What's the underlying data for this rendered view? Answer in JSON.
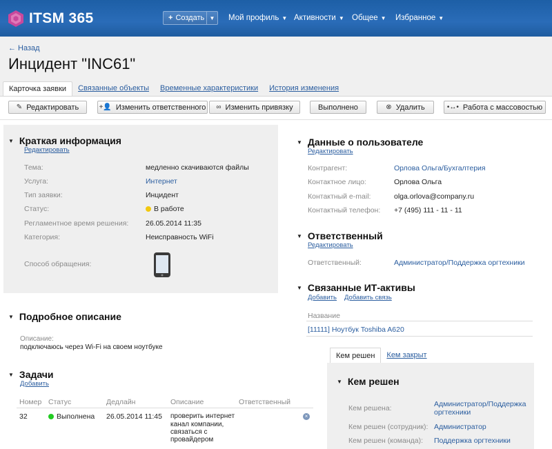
{
  "logo": {
    "text": "ITSM 365"
  },
  "nav": {
    "create": "Создать",
    "items": [
      "Мой профиль",
      "Активности",
      "Общее",
      "Избранное"
    ]
  },
  "header": {
    "back": "← Назад",
    "title": "Инцидент \"INC61\""
  },
  "tabs": [
    "Карточка заявки",
    "Связанные объекты",
    "Временные характеристики",
    "История изменения"
  ],
  "actions": {
    "edit": "Редактировать",
    "change_responsible": "Изменить ответственного",
    "change_binding": "Изменить привязку",
    "done": "Выполнено",
    "delete": "Удалить",
    "bulk": "Работа с массовостью"
  },
  "brief": {
    "title": "Краткая информация",
    "edit": "Редактировать",
    "rows": [
      {
        "label": "Тема:",
        "value": "медленно скачиваются файлы"
      },
      {
        "label": "Услуга:",
        "value": "Интернет"
      },
      {
        "label": "Тип заявки:",
        "value": "Инцидент"
      },
      {
        "label": "Статус:",
        "value": "В работе"
      },
      {
        "label": "Регламентное время решения:",
        "value": "26.05.2014 11:35"
      },
      {
        "label": "Категория:",
        "value": "Неисправность WiFi"
      },
      {
        "label": "Способ обращения:",
        "value": ""
      }
    ]
  },
  "description": {
    "title": "Подробное описание",
    "label": "Описание:",
    "text": "подключаюсь через Wi-Fi на своем ноутбуке"
  },
  "tasks": {
    "title": "Задачи",
    "add": "Добавить",
    "headers": [
      "Номер",
      "Статус",
      "Дедлайн",
      "Описание",
      "Ответственный"
    ],
    "rows": [
      {
        "num": "32",
        "status": "Выполнена",
        "deadline": "26.05.2014 11:45",
        "desc1": "проверить интернет",
        "desc2": "канал компании,",
        "desc3": "связаться с",
        "desc4": "провайдером",
        "resp": ""
      }
    ]
  },
  "user": {
    "title": "Данные о пользователе",
    "edit": "Редактировать",
    "rows": [
      {
        "label": "Контрагент:",
        "value": "Орлова Ольга/Бухгалтерия"
      },
      {
        "label": "Контактное лицо:",
        "value": "Орлова Ольга"
      },
      {
        "label": "Контактный e-mail:",
        "value": "olga.orlova@company.ru"
      },
      {
        "label": "Контактный телефон:",
        "value": "+7 (495) 111 - 11 - 11"
      }
    ]
  },
  "responsible": {
    "title": "Ответственный",
    "edit": "Редактировать",
    "label": "Ответственный:",
    "value": "Администратор/Поддержка оргтехники"
  },
  "assets": {
    "title": "Связанные ИТ-активы",
    "add": "Добавить",
    "add_link": "Добавить связь",
    "col": "Название",
    "item": "[11111] Ноутбук Toshiba A620"
  },
  "resolved": {
    "tabs": [
      "Кем решен",
      "Кем закрыт"
    ],
    "title": "Кем решен",
    "rows": [
      {
        "label": "Кем решена:",
        "value1": "Администратор/Поддержка",
        "value2": "оргтехники"
      },
      {
        "label": "Кем решен (сотрудник):",
        "value1": "Администратор",
        "value2": ""
      },
      {
        "label": "Кем решен (команда):",
        "value1": "Поддержка оргтехники",
        "value2": ""
      }
    ]
  },
  "colors": {
    "brand": "#1f5fa6",
    "status_in_work": "#f2c80f",
    "status_done": "#22cc22",
    "logo": "#c9489c"
  }
}
